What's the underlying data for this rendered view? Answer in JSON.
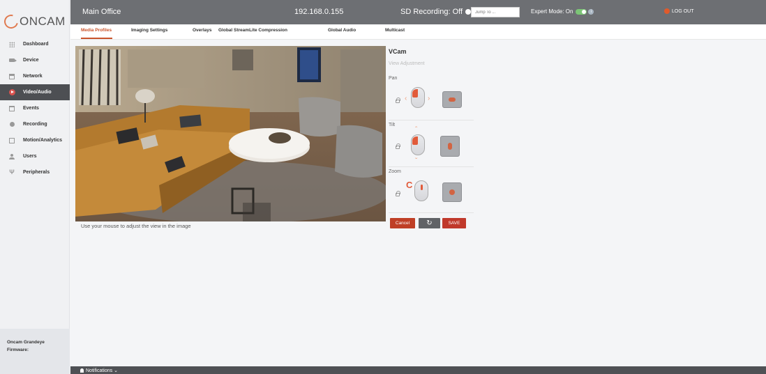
{
  "brand": {
    "logo_text": "ONCAM"
  },
  "sidebar": {
    "items": [
      {
        "label": "Dashboard",
        "icon": "dashboard-icon"
      },
      {
        "label": "Device",
        "icon": "camera-icon"
      },
      {
        "label": "Network",
        "icon": "network-icon"
      },
      {
        "label": "Video/Audio",
        "icon": "video-icon",
        "active": true
      },
      {
        "label": "Events",
        "icon": "calendar-icon"
      },
      {
        "label": "Recording",
        "icon": "record-icon"
      },
      {
        "label": "Motion/Analytics",
        "icon": "analytics-icon"
      },
      {
        "label": "Users",
        "icon": "user-icon"
      },
      {
        "label": "Peripherals",
        "icon": "usb-icon"
      }
    ],
    "footer": {
      "product": "Oncam Grandeye",
      "firmware_label": "Firmware:"
    }
  },
  "header": {
    "title": "Main Office",
    "ip": "192.168.0.155",
    "sd_recording": "SD Recording: Off",
    "jump_placeholder": "Jump To ...",
    "expert_mode": "Expert Mode: On",
    "logout": "LOG OUT"
  },
  "tabs": [
    {
      "label": "Media Profiles",
      "active": true
    },
    {
      "label": "Imaging Settings"
    },
    {
      "label": "Overlays"
    },
    {
      "label": "Global StreamLite Compression"
    },
    {
      "label": "Global Audio"
    },
    {
      "label": "Multicast"
    }
  ],
  "main": {
    "caption": "Use your mouse to adjust the view in the image"
  },
  "vcam": {
    "title": "VCam",
    "subtitle": "View Adjustment",
    "pan_label": "Pan",
    "tilt_label": "Tilt",
    "zoom_label": "Zoom",
    "cancel_label": "Cancel",
    "refresh_symbol": "↻",
    "save_label": "SAVE"
  },
  "notifications": {
    "label": "Notifications ⌄"
  },
  "colors": {
    "accent": "#c9532b",
    "header_bg": "#6d6f73",
    "sidebar_active": "#4d4f53",
    "save_button": "#c0392b"
  }
}
